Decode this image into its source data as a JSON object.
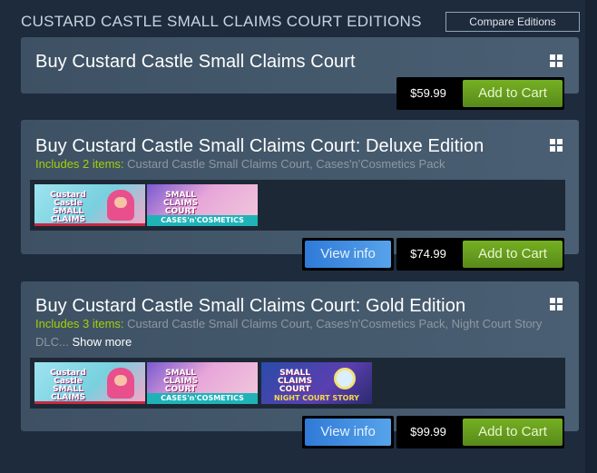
{
  "header": {
    "title": "CUSTARD CASTLE SMALL CLAIMS COURT EDITIONS",
    "compare_label": "Compare Editions"
  },
  "platform_icon": "windows-icon",
  "editions": [
    {
      "title": "Buy Custard Castle Small Claims Court",
      "price": "$59.99",
      "cart_label": "Add to Cart"
    },
    {
      "title": "Buy Custard Castle Small Claims Court: Deluxe Edition",
      "includes_count": "Includes 2 items:",
      "includes_text": " Custard Castle Small Claims Court, Cases'n'Cosmetics Pack",
      "items": [
        {
          "title_art": "Custard Castle SMALL CLAIMS COURT",
          "icon": "game-capsule"
        },
        {
          "title_art": "SMALL CLAIMS COURT",
          "subtitle_art": "CASES'n'COSMETICS",
          "icon": "dlc-capsule"
        }
      ],
      "info_label": "View info",
      "price": "$74.99",
      "cart_label": "Add to Cart"
    },
    {
      "title": "Buy Custard Castle Small Claims Court: Gold Edition",
      "includes_count": "Includes 3 items:",
      "includes_text": " Custard Castle Small Claims Court, Cases'n'Cosmetics Pack, Night Court Story DLC...",
      "show_more": "Show more",
      "items": [
        {
          "title_art": "Custard Castle SMALL CLAIMS COURT",
          "icon": "game-capsule"
        },
        {
          "title_art": "SMALL CLAIMS COURT",
          "subtitle_art": "CASES'n'COSMETICS",
          "icon": "dlc-capsule"
        },
        {
          "title_art": "SMALL CLAIMS COURT",
          "subtitle_art": "NIGHT COURT STORY",
          "icon": "magnifier-icon"
        }
      ],
      "info_label": "View info",
      "price": "$99.99",
      "cart_label": "Add to Cart"
    }
  ],
  "colors": {
    "background": "#1e2b3d",
    "card": "#45596d",
    "cart_green": "#6aa21e",
    "info_blue": "#3b8ee0",
    "includes_green": "#a4d007"
  }
}
